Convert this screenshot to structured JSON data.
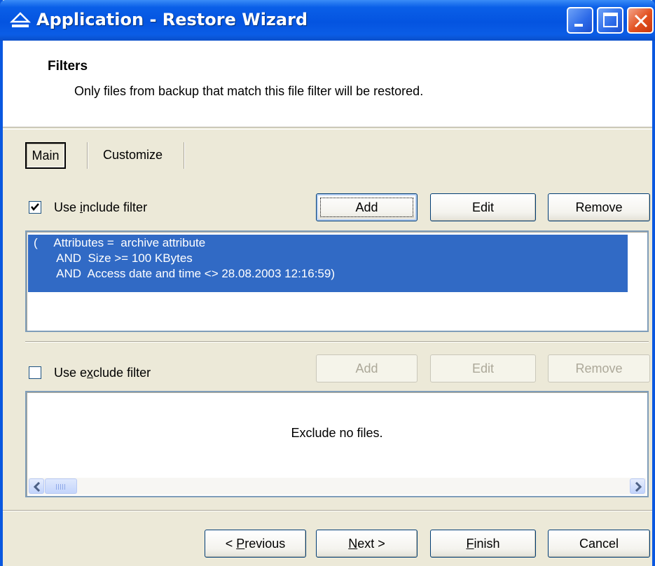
{
  "window": {
    "title": "Application - Restore Wizard",
    "icon": "eject-icon"
  },
  "header": {
    "title": "Filters",
    "description": "Only files from backup that match this file filter will be restored."
  },
  "tabs": [
    {
      "label": "Main",
      "active": true
    },
    {
      "label": "Customize",
      "active": false
    }
  ],
  "include": {
    "checkbox_label_pre": "Use ",
    "checkbox_label_key": "i",
    "checkbox_label_post": "nclude filter",
    "checked": true,
    "buttons": {
      "add": "Add",
      "edit": "Edit",
      "remove": "Remove"
    },
    "items": [
      "(     Attributes =  archive attribute",
      "       AND  Size >= 100 KBytes",
      "       AND  Access date and time <> 28.08.2003 12:16:59)"
    ]
  },
  "exclude": {
    "checkbox_label_pre": "Use e",
    "checkbox_label_key": "x",
    "checkbox_label_post": "clude filter",
    "checked": false,
    "buttons": {
      "add": "Add",
      "edit": "Edit",
      "remove": "Remove"
    },
    "empty_text": "Exclude no files."
  },
  "footer": {
    "previous_pre": "< ",
    "previous_key": "P",
    "previous_post": "revious",
    "next_key": "N",
    "next_post": "ext >",
    "finish_key": "F",
    "finish_post": "inish",
    "cancel": "Cancel"
  },
  "colors": {
    "selection": "#316ac5",
    "titlebar": "#0454e0",
    "dialog": "#ece9d8"
  }
}
